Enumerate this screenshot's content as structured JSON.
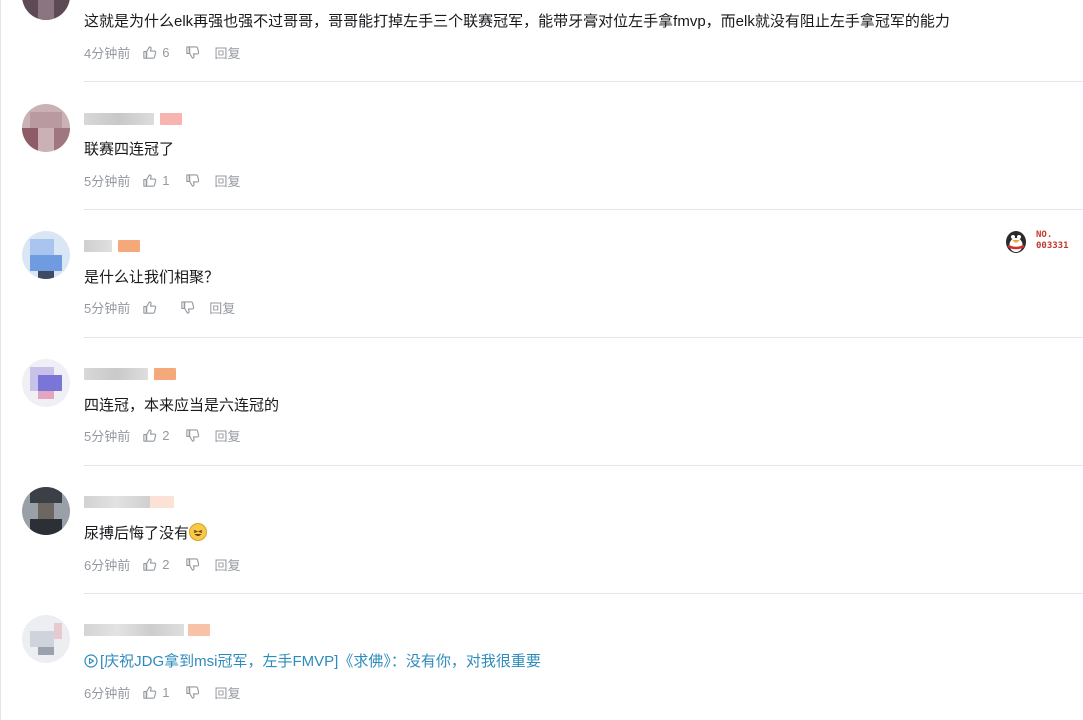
{
  "comments": [
    {
      "text": "这就是为什么elk再强也强不过哥哥，哥哥能打掉左手三个联赛冠军，能带牙膏对位左手拿fmvp，而elk就没有阻止左手拿冠军的能力",
      "time": "4分钟前",
      "likes": "6",
      "reply": "回复"
    },
    {
      "text": "联赛四连冠了",
      "time": "5分钟前",
      "likes": "1",
      "reply": "回复"
    },
    {
      "text": "是什么让我们相聚？",
      "time": "5分钟前",
      "likes": "",
      "reply": "回复",
      "badge": {
        "line1": "NO.",
        "line2": "003331"
      }
    },
    {
      "text": "四连冠，本来应当是六连冠的",
      "time": "5分钟前",
      "likes": "2",
      "reply": "回复"
    },
    {
      "text": "尿搏后悔了没有",
      "time": "6分钟前",
      "likes": "2",
      "reply": "回复"
    },
    {
      "text": "[庆祝JDG拿到msi冠军，左手FMVP]《求佛》：没有你，对我很重要",
      "time": "6分钟前",
      "likes": "1",
      "reply": "回复"
    }
  ],
  "icons": {
    "like": "thumbs-up-icon",
    "dislike": "thumbs-down-icon",
    "emoji": "laughing-emoji-icon",
    "video": "play-circle-icon",
    "badge": "qq-penguin-icon"
  },
  "colors": {
    "link": "#2e8bbd",
    "meta": "#9499a0",
    "level_badge": "#f5a97a"
  }
}
